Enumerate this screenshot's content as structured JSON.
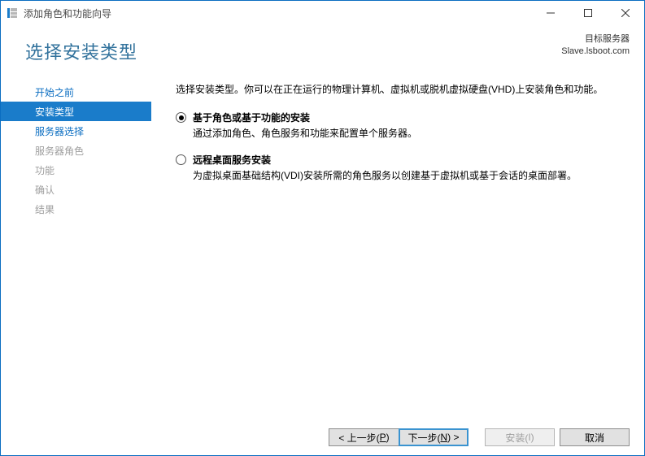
{
  "titlebar": {
    "title": "添加角色和功能向导"
  },
  "header": {
    "title": "选择安装类型",
    "meta_label": "目标服务器",
    "meta_value": "Slave.lsboot.com"
  },
  "sidebar": {
    "items": [
      {
        "label": "开始之前",
        "state": "enabled"
      },
      {
        "label": "安装类型",
        "state": "selected"
      },
      {
        "label": "服务器选择",
        "state": "enabled"
      },
      {
        "label": "服务器角色",
        "state": "disabled"
      },
      {
        "label": "功能",
        "state": "disabled"
      },
      {
        "label": "确认",
        "state": "disabled"
      },
      {
        "label": "结果",
        "state": "disabled"
      }
    ]
  },
  "content": {
    "intro": "选择安装类型。你可以在正在运行的物理计算机、虚拟机或脱机虚拟硬盘(VHD)上安装角色和功能。",
    "options": [
      {
        "label": "基于角色或基于功能的安装",
        "desc": "通过添加角色、角色服务和功能来配置单个服务器。",
        "checked": true
      },
      {
        "label": "远程桌面服务安装",
        "desc": "为虚拟桌面基础结构(VDI)安装所需的角色服务以创建基于虚拟机或基于会话的桌面部署。",
        "checked": false
      }
    ]
  },
  "footer": {
    "previous_prefix": "< 上一步(",
    "previous_key": "P",
    "previous_suffix": ")",
    "next_prefix": "下一步(",
    "next_key": "N",
    "next_suffix": ") >",
    "install_prefix": "安装(",
    "install_key": "I",
    "install_suffix": ")",
    "cancel": "取消"
  }
}
